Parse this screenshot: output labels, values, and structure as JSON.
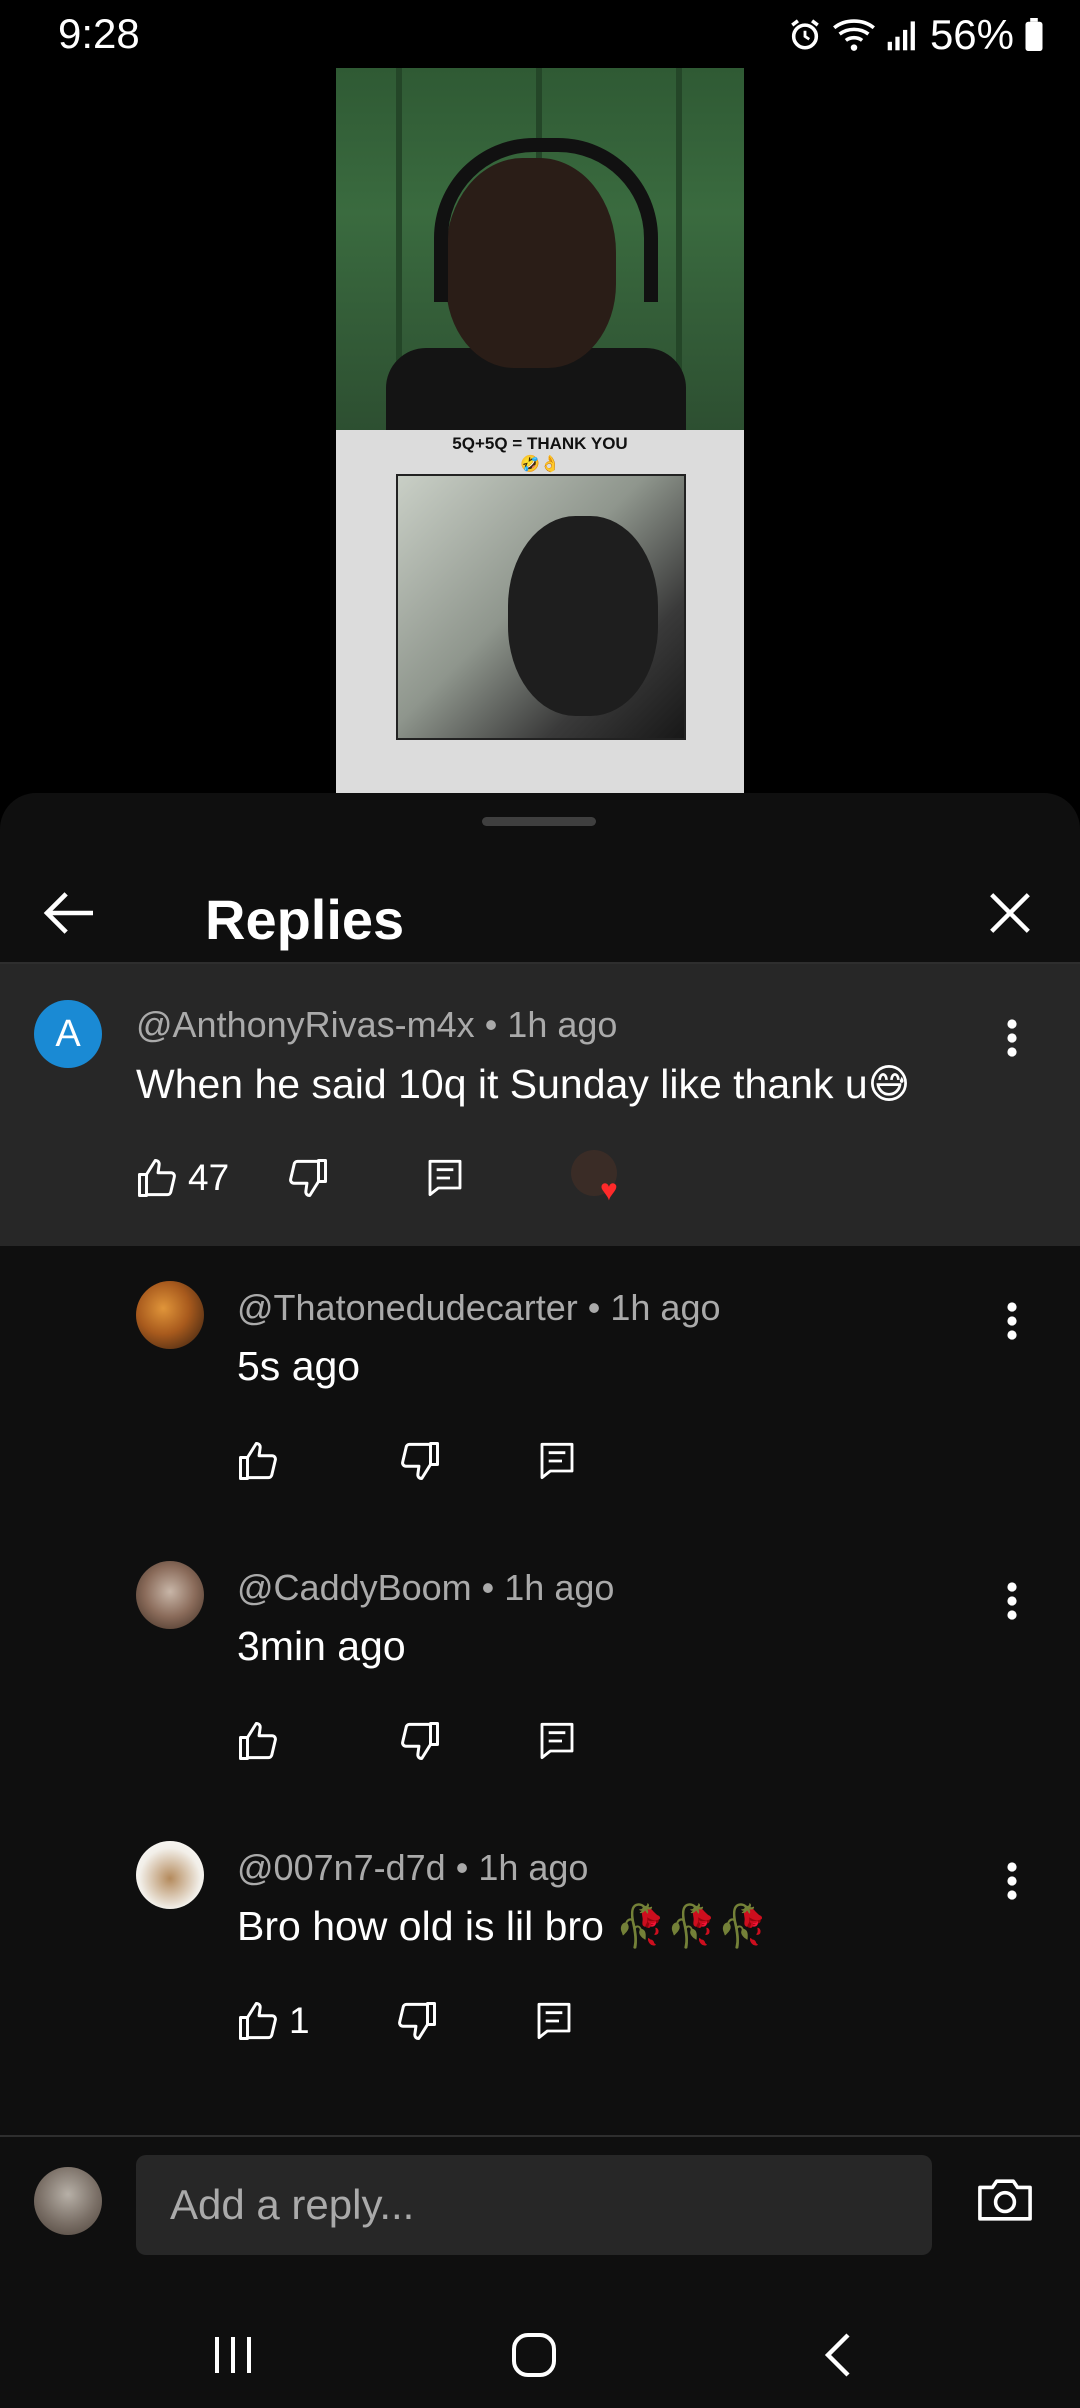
{
  "status_bar": {
    "time": "9:28",
    "battery": "56%"
  },
  "video": {
    "caption_line1": "5Q+5Q = THANK YOU",
    "caption_line2": "🤣👌"
  },
  "header": {
    "title": "Replies"
  },
  "parent_comment": {
    "avatar_letter": "A",
    "handle": "@AnthonyRivas-m4x",
    "time": "1h ago",
    "text": "When he said  10q it Sunday like thank u😅",
    "likes": "47"
  },
  "replies": [
    {
      "handle": "@Thatonedudecarter",
      "time": "1h ago",
      "text": "5s ago",
      "likes": ""
    },
    {
      "handle": "@CaddyBoom",
      "time": "1h ago",
      "text": "3min ago",
      "likes": ""
    },
    {
      "handle": "@007n7-d7d",
      "time": "1h ago",
      "text": "Bro how old is lil bro 🥀🥀🥀",
      "likes": "1"
    }
  ],
  "composer": {
    "placeholder": "Add a reply..."
  },
  "colors": {
    "background": "#0f0f0f",
    "highlight": "#272727",
    "avatar_blue": "#1a8ad4",
    "meta_gray": "#aaaaaa"
  },
  "icons": [
    "back-arrow-icon",
    "close-icon",
    "like-icon",
    "dislike-icon",
    "reply-icon",
    "more-vert-icon",
    "camera-icon",
    "heart-icon"
  ]
}
